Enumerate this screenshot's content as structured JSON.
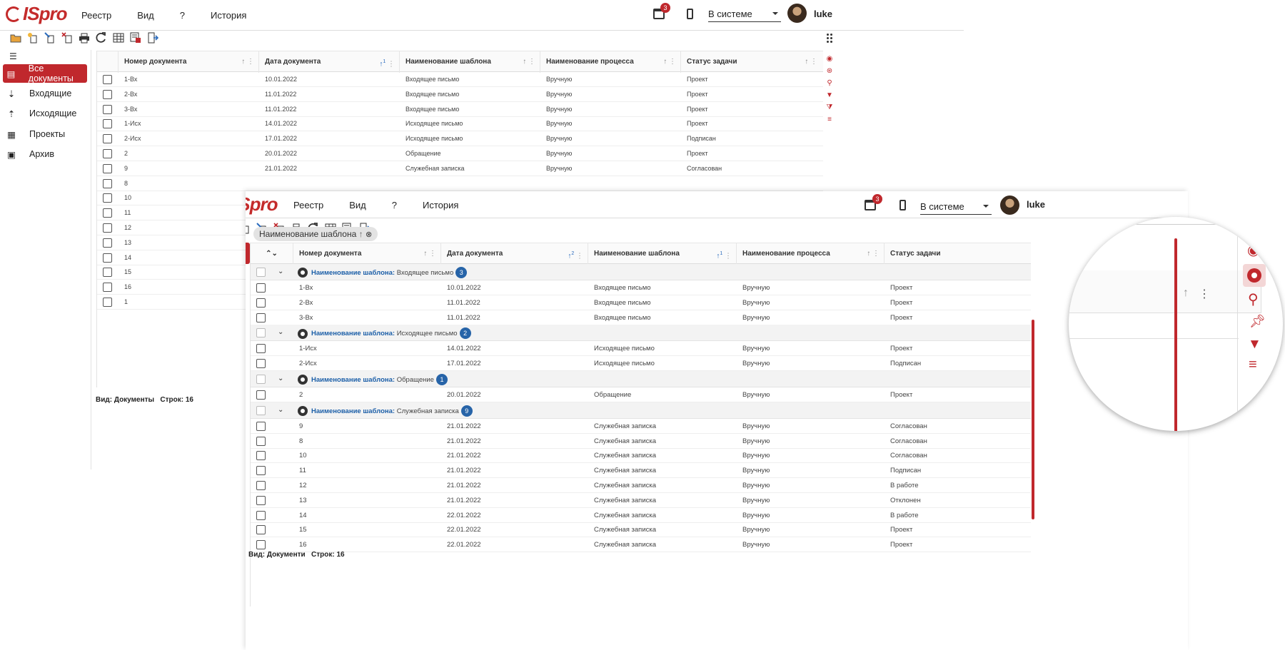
{
  "app": {
    "logo": "ISpro"
  },
  "menu": {
    "items": [
      "Реестр",
      "Вид",
      "?",
      "История"
    ]
  },
  "header": {
    "notif_count": "3",
    "status": "В системе",
    "user": "luke"
  },
  "sidebar": {
    "items": [
      "Все документы",
      "Входящие",
      "Исходящие",
      "Проекты",
      "Архив"
    ]
  },
  "columns": [
    "Номер документа",
    "Дата документа",
    "Наименование шаблона",
    "Наименование процесса",
    "Статус задачи"
  ],
  "sort_badges": {
    "back_date": "1",
    "front_date": "2",
    "front_template": "1"
  },
  "back_rows": [
    [
      "1-Вх",
      "10.01.2022",
      "Входящее письмо",
      "Вручную",
      "Проект"
    ],
    [
      "2-Вх",
      "11.01.2022",
      "Входящее письмо",
      "Вручную",
      "Проект"
    ],
    [
      "3-Вх",
      "11.01.2022",
      "Входящее письмо",
      "Вручную",
      "Проект"
    ],
    [
      "1-Исх",
      "14.01.2022",
      "Исходящее письмо",
      "Вручную",
      "Проект"
    ],
    [
      "2-Исх",
      "17.01.2022",
      "Исходящее письмо",
      "Вручную",
      "Подписан"
    ],
    [
      "2",
      "20.01.2022",
      "Обращение",
      "Вручную",
      "Проект"
    ],
    [
      "9",
      "21.01.2022",
      "Служебная записка",
      "Вручную",
      "Согласован"
    ],
    [
      "8"
    ],
    [
      "10"
    ],
    [
      "11"
    ],
    [
      "12"
    ],
    [
      "13"
    ],
    [
      "14"
    ],
    [
      "15"
    ],
    [
      "16"
    ],
    [
      "1"
    ]
  ],
  "back_footer": {
    "view": "Вид: Документы",
    "rows": "Строк: 16"
  },
  "group_chip": "Наименование шаблона",
  "group_label": "Наименование шаблона:",
  "groups": [
    {
      "name": "Входящее письмо",
      "count": "3",
      "rows": [
        [
          "1-Вх",
          "10.01.2022",
          "Входящее письмо",
          "Вручную",
          "Проект"
        ],
        [
          "2-Вх",
          "11.01.2022",
          "Входящее письмо",
          "Вручную",
          "Проект"
        ],
        [
          "3-Вх",
          "11.01.2022",
          "Входящее письмо",
          "Вручную",
          "Проект"
        ]
      ]
    },
    {
      "name": "Исходящее письмо",
      "count": "2",
      "rows": [
        [
          "1-Исх",
          "14.01.2022",
          "Исходящее письмо",
          "Вручную",
          "Проект"
        ],
        [
          "2-Исх",
          "17.01.2022",
          "Исходящее письмо",
          "Вручную",
          "Подписан"
        ]
      ]
    },
    {
      "name": "Обращение",
      "count": "1",
      "rows": [
        [
          "2",
          "20.01.2022",
          "Обращение",
          "Вручную",
          "Проект"
        ]
      ]
    },
    {
      "name": "Служебная записка",
      "count": "9",
      "rows": [
        [
          "9",
          "21.01.2022",
          "Служебная записка",
          "Вручную",
          "Согласован"
        ],
        [
          "8",
          "21.01.2022",
          "Служебная записка",
          "Вручную",
          "Согласован"
        ],
        [
          "10",
          "21.01.2022",
          "Служебная записка",
          "Вручную",
          "Согласован"
        ],
        [
          "11",
          "21.01.2022",
          "Служебная записка",
          "Вручную",
          "Подписан"
        ],
        [
          "12",
          "21.01.2022",
          "Служебная записка",
          "Вручную",
          "В работе"
        ],
        [
          "13",
          "21.01.2022",
          "Служебная записка",
          "Вручную",
          "Отклонен"
        ],
        [
          "14",
          "22.01.2022",
          "Служебная записка",
          "Вручную",
          "В работе"
        ],
        [
          "15",
          "22.01.2022",
          "Служебная записка",
          "Вручную",
          "Проект"
        ],
        [
          "16",
          "22.01.2022",
          "Служебная записка",
          "Вручную",
          "Проект"
        ]
      ]
    }
  ],
  "front_footer": {
    "view": "Вид: Документи",
    "rows": "Строк: 16"
  },
  "icons": {
    "toolbar": [
      "open-folder-icon",
      "new-doc-icon",
      "edit-doc-icon",
      "delete-doc-icon",
      "print-icon",
      "refresh-icon",
      "table-icon",
      "export-icon",
      "exit-icon"
    ],
    "right_tools": [
      "eye-icon",
      "group-icon",
      "search-icon",
      "pin-icon",
      "filter-icon",
      "sort-icon"
    ]
  },
  "colors": {
    "accent": "#c0282d",
    "group_link": "#1c5fa8",
    "count_badge": "#2764a8"
  }
}
